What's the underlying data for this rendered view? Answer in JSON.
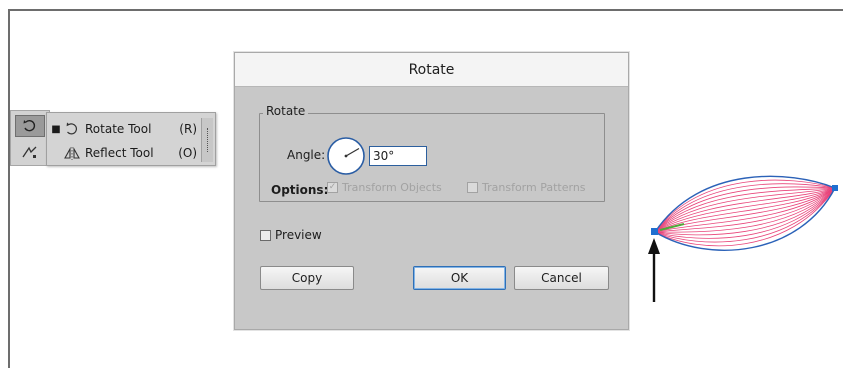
{
  "flyout": {
    "items": [
      {
        "label": "Rotate Tool",
        "shortcut": "(R)",
        "selected_marker": "■",
        "icon": "rotate-icon"
      },
      {
        "label": "Reflect Tool",
        "shortcut": "(O)",
        "selected_marker": "",
        "icon": "reflect-icon"
      }
    ]
  },
  "dialog": {
    "title": "Rotate",
    "group_title": "Rotate",
    "angle_label": "Angle:",
    "angle_value": "30°",
    "angle_degrees": 30,
    "options_label": "Options:",
    "options": [
      {
        "label": "Transform Objects",
        "checked": true,
        "enabled": false
      },
      {
        "label": "Transform Patterns",
        "checked": false,
        "enabled": false
      }
    ],
    "preview_label": "Preview",
    "preview_checked": false,
    "buttons": {
      "copy": "Copy",
      "ok": "OK",
      "cancel": "Cancel"
    }
  },
  "colors": {
    "shape_fill_stroke": "#e8447a",
    "shape_outline": "#2b62b8",
    "anchor": "#1f6fd0",
    "pivot": "#4fa83a",
    "arrow": "#111111"
  }
}
